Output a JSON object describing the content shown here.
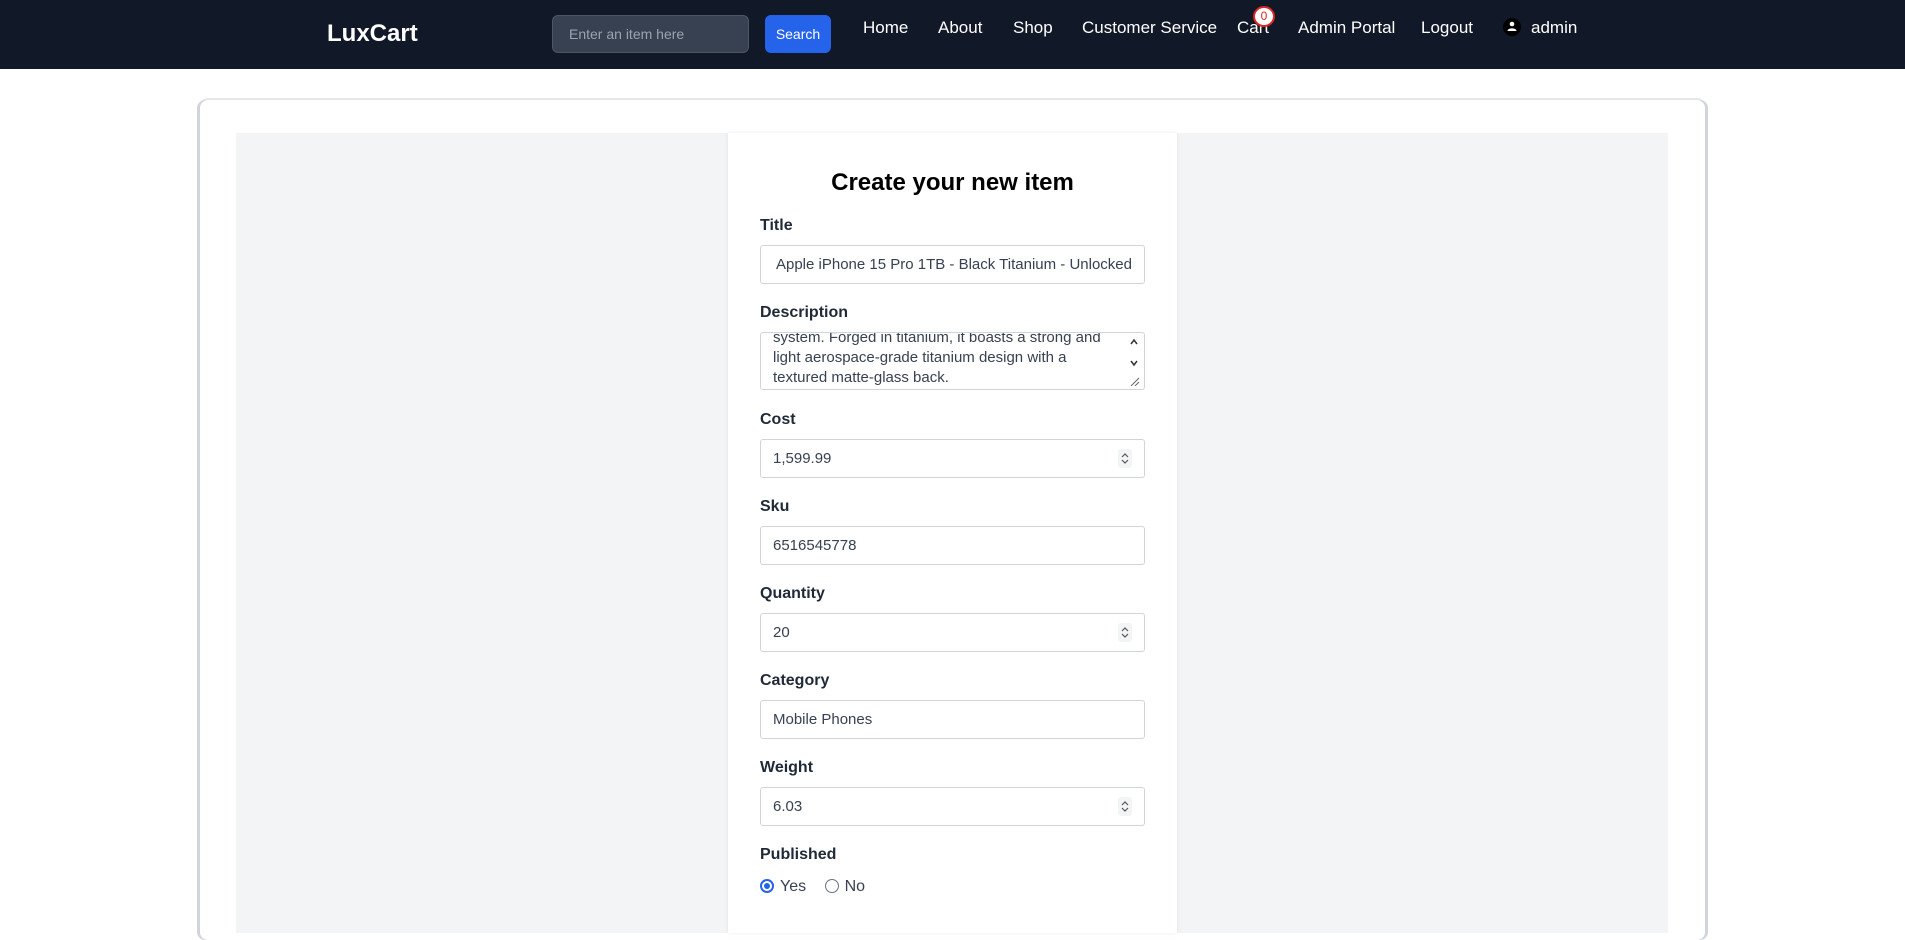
{
  "header": {
    "brand": "LuxCart",
    "search_placeholder": "Enter an item here",
    "search_button": "Search",
    "nav": [
      "Home",
      "About",
      "Shop",
      "Customer Service",
      "Cart",
      "Admin Portal",
      "Logout"
    ],
    "cart_count": "0",
    "username": "admin"
  },
  "form": {
    "title": "Create your new item",
    "fields": {
      "title_label": "Title",
      "title_value": "Apple iPhone 15 Pro 1TB - Black Titanium - Unlocked",
      "description_label": "Description",
      "description_value": "system. Forged in titanium, it boasts a strong and light aerospace-grade titanium design with a textured matte-glass back.",
      "cost_label": "Cost",
      "cost_value": "1,599.99",
      "sku_label": "Sku",
      "sku_value": "6516545778",
      "quantity_label": "Quantity",
      "quantity_value": "20",
      "category_label": "Category",
      "category_value": "Mobile Phones",
      "weight_label": "Weight",
      "weight_value": "6.03",
      "published_label": "Published",
      "published_yes": "Yes",
      "published_no": "No",
      "published_selected": "Yes"
    }
  },
  "icons": {
    "user": "user-icon",
    "spinner": "spinner-icon",
    "scroll": "scroll-arrows-icon"
  },
  "colors": {
    "navbar": "#111827",
    "accent": "#2563eb",
    "badge": "#dc2626"
  }
}
